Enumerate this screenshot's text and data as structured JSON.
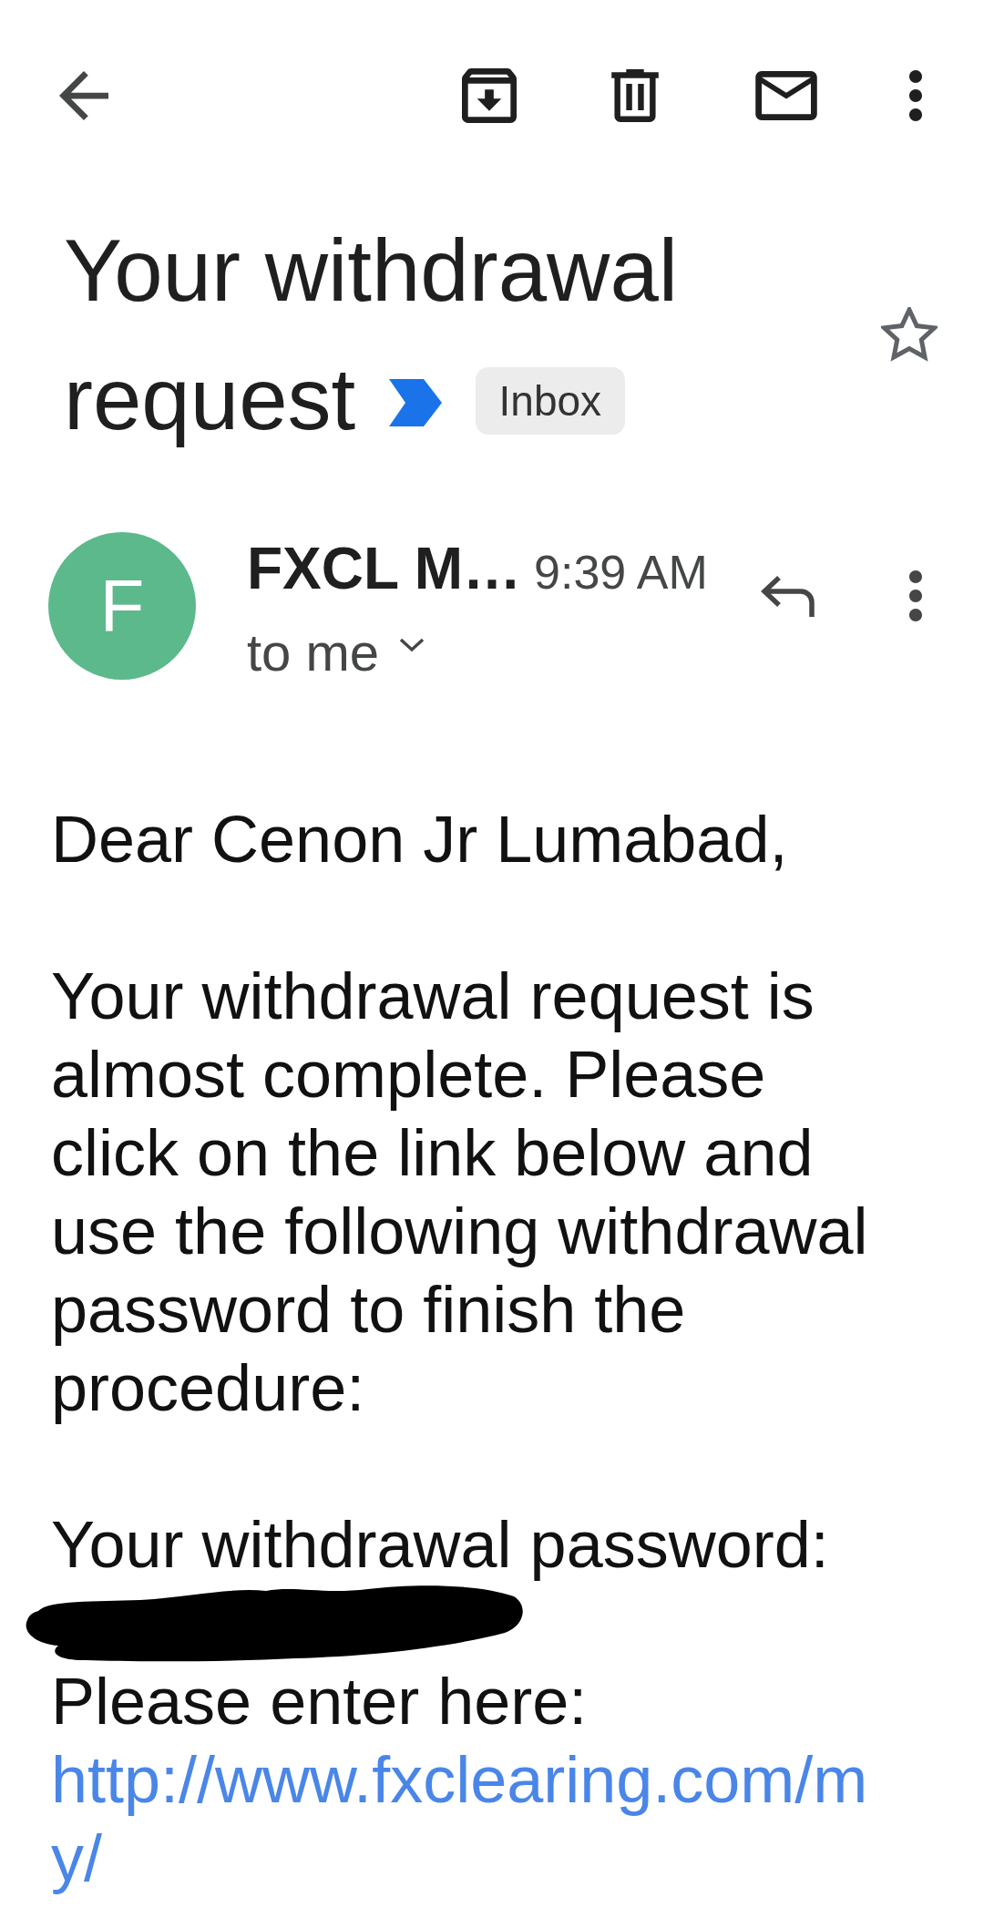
{
  "subject": {
    "title": "Your withdrawal request",
    "important": true,
    "label": "Inbox",
    "starred": false
  },
  "message": {
    "avatar_letter": "F",
    "sender": "FXCL M…",
    "time": "9:39 AM",
    "recipients": "to me"
  },
  "body": [
    {
      "kind": "paragraph",
      "text": "Dear Cenon Jr Lumabad,"
    },
    {
      "kind": "paragraph",
      "text": "Your withdrawal request is almost complete. Please click on the link below and use the following withdrawal password to finish the procedure:"
    },
    {
      "kind": "line",
      "text": "Your withdrawal password:"
    },
    {
      "kind": "redaction"
    },
    {
      "kind": "line",
      "text": "Please enter here:"
    },
    {
      "kind": "link",
      "text": "http://www.fxclearing.com/my/"
    }
  ]
}
